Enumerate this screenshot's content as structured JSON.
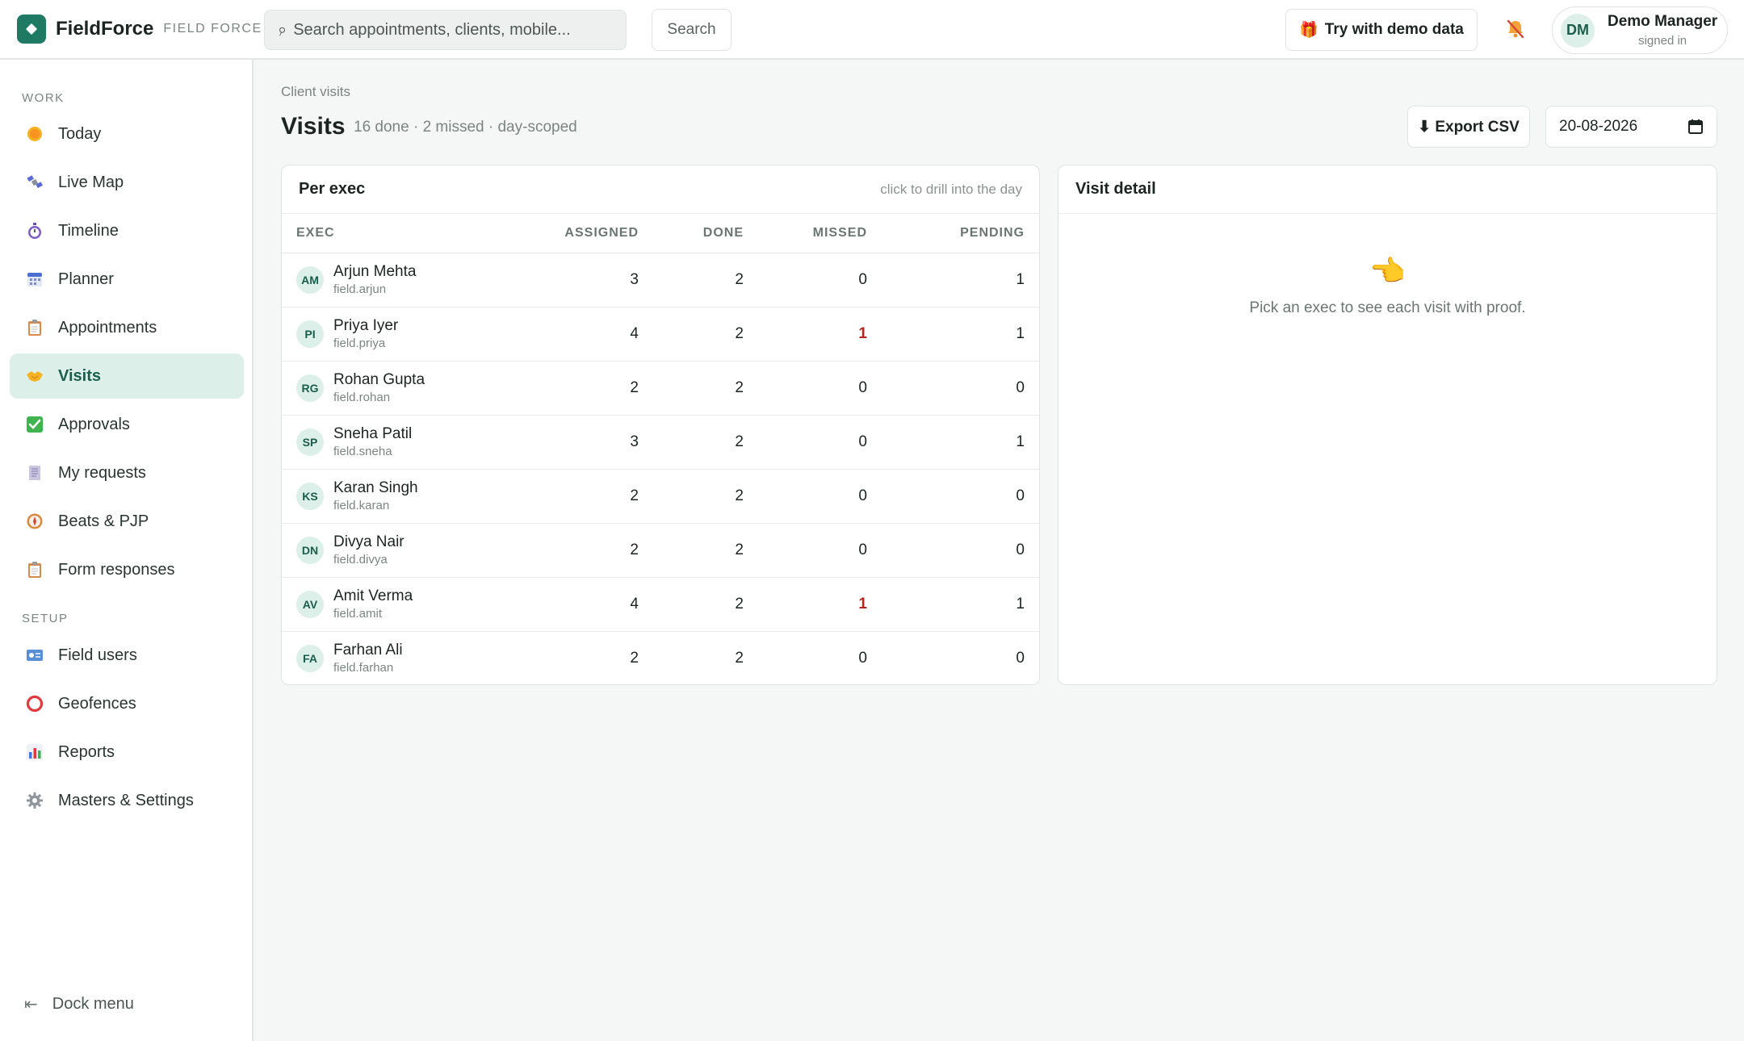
{
  "brand": {
    "name": "FieldForce",
    "sub": "FIELD FORCE"
  },
  "topbar": {
    "search_placeholder": "Search appointments, clients, mobile...",
    "search_button": "Search",
    "demo_button": "Try with demo data",
    "user": {
      "initials": "DM",
      "name": "Demo Manager",
      "status": "signed in"
    }
  },
  "sidebar": {
    "work_label": "WORK",
    "work_items": [
      {
        "label": "Today",
        "icon": "sun-icon"
      },
      {
        "label": "Live Map",
        "icon": "satellite-icon"
      },
      {
        "label": "Timeline",
        "icon": "stopwatch-icon"
      },
      {
        "label": "Planner",
        "icon": "calendar-icon"
      },
      {
        "label": "Appointments",
        "icon": "clipboard-icon"
      },
      {
        "label": "Visits",
        "icon": "handshake-icon",
        "active": true
      },
      {
        "label": "Approvals",
        "icon": "check-box-icon"
      },
      {
        "label": "My requests",
        "icon": "receipt-icon"
      },
      {
        "label": "Beats & PJP",
        "icon": "compass-icon"
      },
      {
        "label": "Form responses",
        "icon": "clipboard-icon"
      }
    ],
    "setup_label": "SETUP",
    "setup_items": [
      {
        "label": "Field users",
        "icon": "id-card-icon"
      },
      {
        "label": "Geofences",
        "icon": "circle-icon"
      },
      {
        "label": "Reports",
        "icon": "bar-chart-icon"
      },
      {
        "label": "Masters & Settings",
        "icon": "gear-icon"
      }
    ],
    "dock_label": "Dock menu"
  },
  "page": {
    "breadcrumb": "Client visits",
    "title": "Visits",
    "subtitle": "16 done · 2 missed · day-scoped",
    "export_button": "⬇ Export CSV",
    "date": "20-08-2026"
  },
  "per_exec": {
    "title": "Per exec",
    "hint": "click to drill into the day",
    "columns": [
      "EXEC",
      "ASSIGNED",
      "DONE",
      "MISSED",
      "PENDING"
    ],
    "rows": [
      {
        "initials": "AM",
        "name": "Arjun Mehta",
        "user": "field.arjun",
        "assigned": "3",
        "done": "2",
        "missed": "0",
        "pending": "1"
      },
      {
        "initials": "PI",
        "name": "Priya Iyer",
        "user": "field.priya",
        "assigned": "4",
        "done": "2",
        "missed": "1",
        "pending": "1"
      },
      {
        "initials": "RG",
        "name": "Rohan Gupta",
        "user": "field.rohan",
        "assigned": "2",
        "done": "2",
        "missed": "0",
        "pending": "0"
      },
      {
        "initials": "SP",
        "name": "Sneha Patil",
        "user": "field.sneha",
        "assigned": "3",
        "done": "2",
        "missed": "0",
        "pending": "1"
      },
      {
        "initials": "KS",
        "name": "Karan Singh",
        "user": "field.karan",
        "assigned": "2",
        "done": "2",
        "missed": "0",
        "pending": "0"
      },
      {
        "initials": "DN",
        "name": "Divya Nair",
        "user": "field.divya",
        "assigned": "2",
        "done": "2",
        "missed": "0",
        "pending": "0"
      },
      {
        "initials": "AV",
        "name": "Amit Verma",
        "user": "field.amit",
        "assigned": "4",
        "done": "2",
        "missed": "1",
        "pending": "1"
      },
      {
        "initials": "FA",
        "name": "Farhan Ali",
        "user": "field.farhan",
        "assigned": "2",
        "done": "2",
        "missed": "0",
        "pending": "0"
      }
    ]
  },
  "visit_detail": {
    "title": "Visit detail",
    "empty_message": "Pick an exec to see each visit with proof."
  }
}
